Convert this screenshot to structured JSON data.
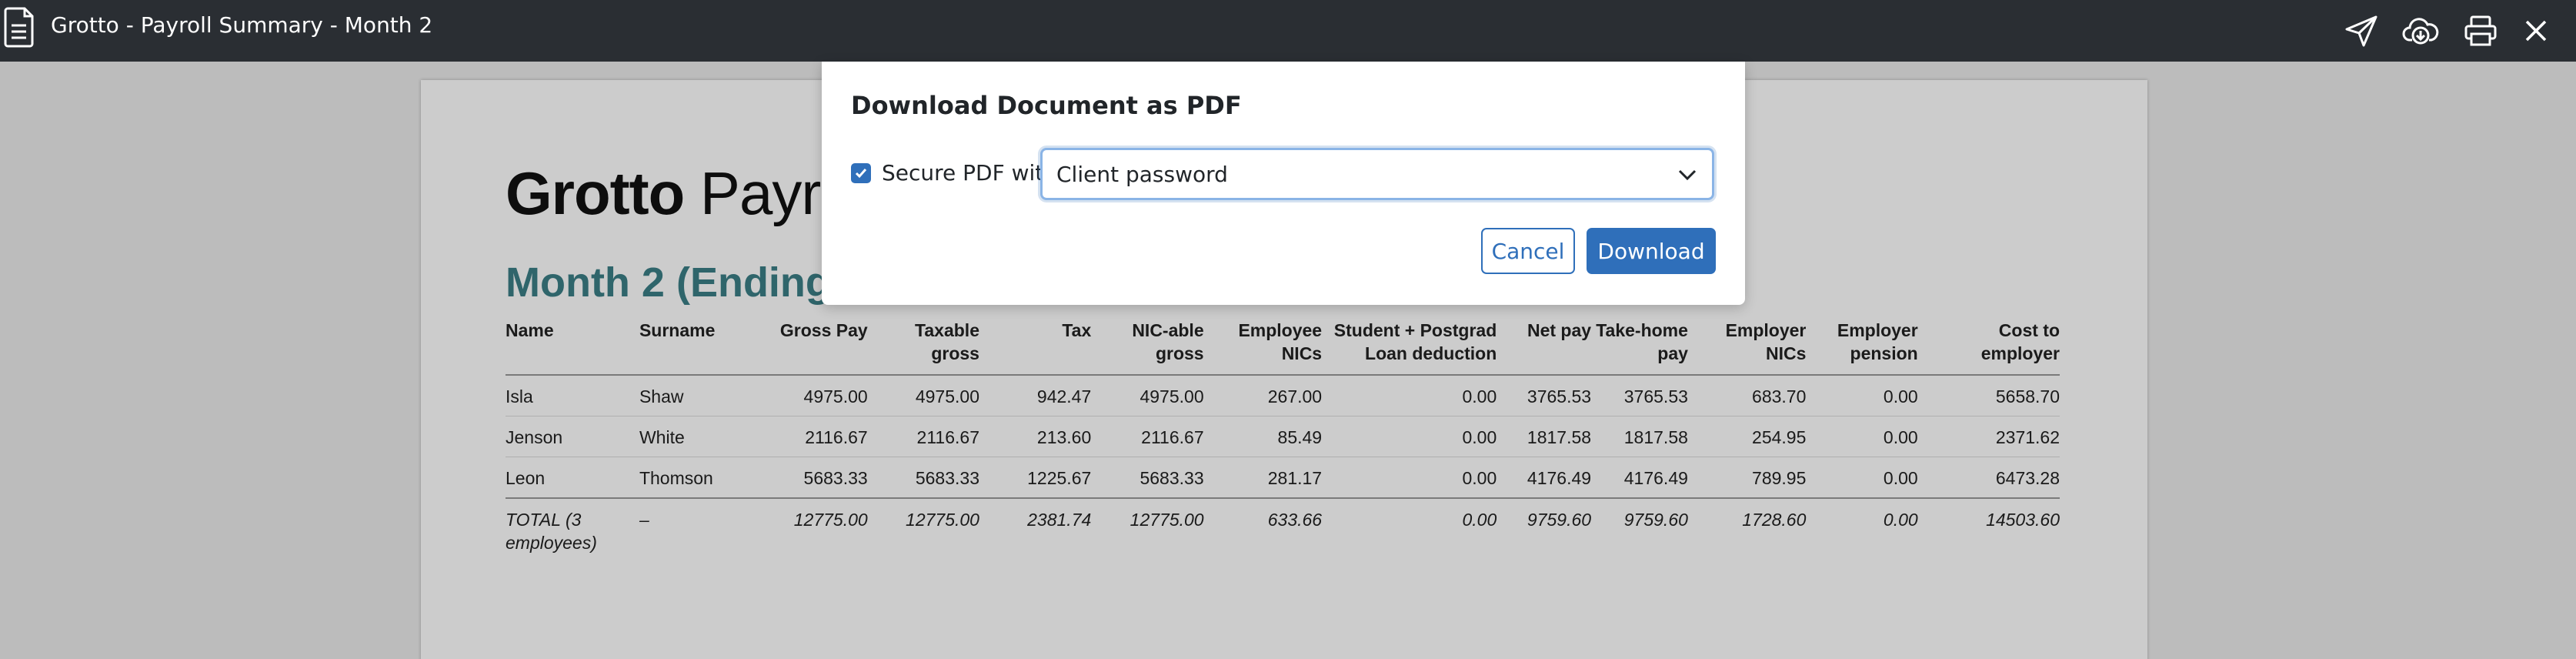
{
  "window": {
    "title": "Grotto - Payroll Summary - Month 2",
    "actions": [
      {
        "name": "send-icon",
        "label": "Send"
      },
      {
        "name": "cloud-download-icon",
        "label": "Download"
      },
      {
        "name": "print-icon",
        "label": "Print"
      },
      {
        "name": "close-icon",
        "label": "Close"
      }
    ]
  },
  "document": {
    "company_bold": "Grotto",
    "company_light": " Payroll",
    "month_heading": "Month 2 (Ending",
    "columns": [
      {
        "label": "Name",
        "align": "l"
      },
      {
        "label": "Surname",
        "align": "l"
      },
      {
        "label": "Gross Pay",
        "align": "r"
      },
      {
        "label": "Taxable gross",
        "align": "r"
      },
      {
        "label": "Tax",
        "align": "r"
      },
      {
        "label": "NIC-able gross",
        "align": "r"
      },
      {
        "label": "Employee NICs",
        "align": "r"
      },
      {
        "label": "Student + Postgrad Loan deduction",
        "align": "r"
      },
      {
        "label": "Net pay",
        "align": "r"
      },
      {
        "label": "Take-home pay",
        "align": "r"
      },
      {
        "label": "Employer NICs",
        "align": "r"
      },
      {
        "label": "Employer pension",
        "align": "r"
      },
      {
        "label": "Cost to employer",
        "align": "r"
      }
    ],
    "rows": [
      [
        "Isla",
        "Shaw",
        "4975.00",
        "4975.00",
        "942.47",
        "4975.00",
        "267.00",
        "0.00",
        "3765.53",
        "3765.53",
        "683.70",
        "0.00",
        "5658.70"
      ],
      [
        "Jenson",
        "White",
        "2116.67",
        "2116.67",
        "213.60",
        "2116.67",
        "85.49",
        "0.00",
        "1817.58",
        "1817.58",
        "254.95",
        "0.00",
        "2371.62"
      ],
      [
        "Leon",
        "Thomson",
        "5683.33",
        "5683.33",
        "1225.67",
        "5683.33",
        "281.17",
        "0.00",
        "4176.49",
        "4176.49",
        "789.95",
        "0.00",
        "6473.28"
      ]
    ],
    "total": [
      "TOTAL (3 employees)",
      "–",
      "12775.00",
      "12775.00",
      "2381.74",
      "12775.00",
      "633.66",
      "0.00",
      "9759.60",
      "9759.60",
      "1728.60",
      "0.00",
      "14503.60"
    ]
  },
  "dialog": {
    "title": "Download Document as PDF",
    "secure_checked": true,
    "secure_label": "Secure PDF with",
    "secure_option": "Client password",
    "cancel_label": "Cancel",
    "download_label": "Download"
  },
  "colors": {
    "topbar": "#2a2e33",
    "accent": "#2f6fba",
    "heading_teal": "#3b7f86"
  }
}
